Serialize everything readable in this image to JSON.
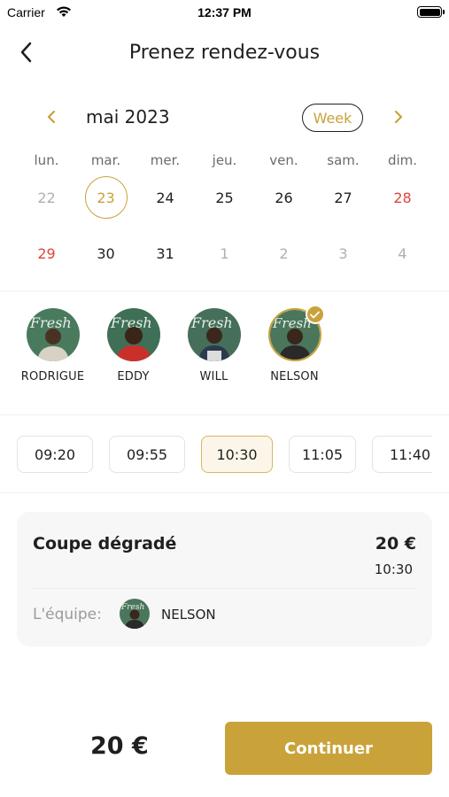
{
  "status_bar": {
    "carrier": "Carrier",
    "time": "12:37 PM"
  },
  "header": {
    "title": "Prenez rendez-vous",
    "back_icon": "chevron-left-icon"
  },
  "calendar": {
    "month_label": "mai 2023",
    "view_toggle_label": "Week",
    "prev_icon": "chevron-left-icon",
    "next_icon": "chevron-right-icon",
    "weekdays": [
      "lun.",
      "mar.",
      "mer.",
      "jeu.",
      "ven.",
      "sam.",
      "dim."
    ],
    "weeks": [
      [
        {
          "label": "22",
          "state": "muted"
        },
        {
          "label": "23",
          "state": "selected"
        },
        {
          "label": "24",
          "state": "normal"
        },
        {
          "label": "25",
          "state": "normal"
        },
        {
          "label": "26",
          "state": "normal"
        },
        {
          "label": "27",
          "state": "normal"
        },
        {
          "label": "28",
          "state": "sunday"
        }
      ],
      [
        {
          "label": "29",
          "state": "sunday"
        },
        {
          "label": "30",
          "state": "normal"
        },
        {
          "label": "31",
          "state": "normal"
        },
        {
          "label": "1",
          "state": "muted"
        },
        {
          "label": "2",
          "state": "muted"
        },
        {
          "label": "3",
          "state": "muted"
        },
        {
          "label": "4",
          "state": "muted"
        }
      ]
    ]
  },
  "barbers": [
    {
      "name": "RODRIGUE",
      "selected": false
    },
    {
      "name": "EDDY",
      "selected": false
    },
    {
      "name": "WILL",
      "selected": false
    },
    {
      "name": "NELSON",
      "selected": true
    }
  ],
  "time_slots": [
    {
      "label": "09:20",
      "selected": false
    },
    {
      "label": "09:55",
      "selected": false
    },
    {
      "label": "10:30",
      "selected": true
    },
    {
      "label": "11:05",
      "selected": false
    },
    {
      "label": "11:40",
      "selected": false
    }
  ],
  "summary": {
    "service": "Coupe dégradé",
    "price": "20 €",
    "time": "10:30",
    "team_label": "L'équipe:",
    "team_member": "NELSON"
  },
  "footer": {
    "total": "20 €",
    "continue_label": "Continuer"
  },
  "colors": {
    "accent": "#c9a23a",
    "sunday": "#e0453b",
    "muted": "#b0b0b0",
    "card_bg": "#f7f7f7"
  }
}
